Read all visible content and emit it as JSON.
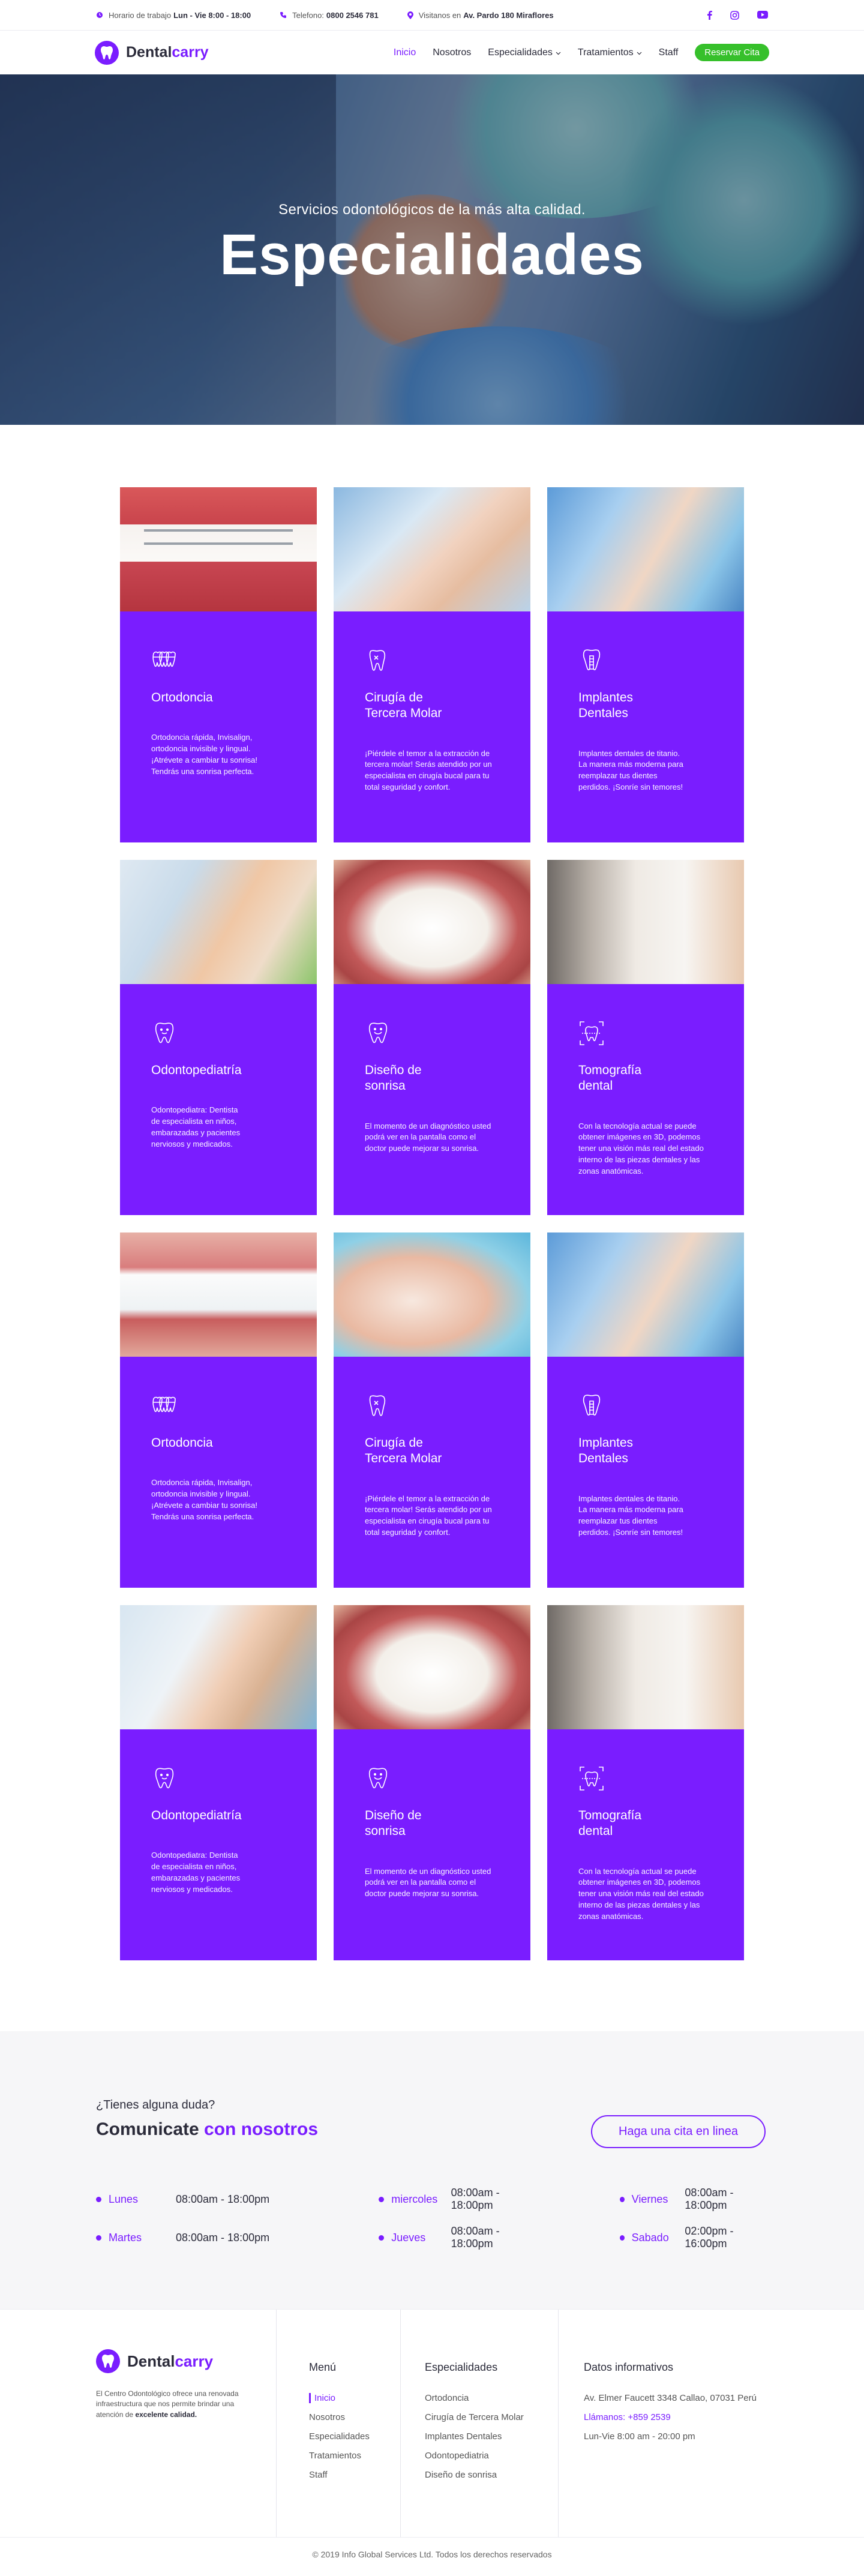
{
  "topbar": {
    "hours_label": "Horario de trabajo",
    "hours_value": "Lun - Vie 8:00 - 18:00",
    "phone_label": "Telefono:",
    "phone_value": "0800 2546 781",
    "visit_label": "Visitanos en",
    "visit_value": "Av. Pardo 180 Miraflores",
    "social": [
      "facebook-icon",
      "instagram-icon",
      "youtube-icon"
    ]
  },
  "nav": {
    "logo_dental": "Dental",
    "logo_carry": "carry",
    "items": [
      "Inicio",
      "Nosotros",
      "Especialidades",
      "Tratamientos",
      "Staff"
    ],
    "cta": "Reservar Cita"
  },
  "hero": {
    "subtitle": "Servicios odontológicos de la más alta calidad.",
    "title": "Especialidades"
  },
  "cards": [
    {
      "title": "Ortodoncia",
      "text": "Ortodoncia rápida, Invisalign,\nortodoncia invisible y lingual.\n¡Atrévete a cambiar tu sonrisa!\nTendrás una sonrisa perfecta.",
      "image": "teeth",
      "icon": "braces-tooth-icon"
    },
    {
      "title": "Cirugía de\nTercera Molar",
      "text": "¡Piérdele el temor a la extracción de\ntercera molar! Serás atendido por un\nespecialista en cirugía bucal para tu\ntotal seguridad y confort.",
      "image": "clinic",
      "icon": "molar-icon"
    },
    {
      "title": "Implantes\nDentales",
      "text": "Implantes dentales de titanio.\nLa manera más moderna para\nreemplazar tus dientes\nperdidos. ¡Sonríe sin temores!",
      "image": "clinic2",
      "icon": "implant-icon"
    },
    {
      "title": "Odontopediatría",
      "text": "Odontopediatra: Dentista\nde especialista en niños,\nembarazadas y pacientes\nnerviosos y medicados.",
      "image": "kid",
      "icon": "kid-tooth-icon"
    },
    {
      "title": "Diseño de\nsonrisa",
      "text": "El momento de un diagnóstico usted\npodrá ver en la pantalla como el\ndoctor puede mejorar su sonrisa.",
      "image": "smile",
      "icon": "smile-tooth-icon"
    },
    {
      "title": "Tomografía\ndental",
      "text": "Con la tecnología actual se puede\nobtener imágenes en 3D, podemos\ntener una visión más real del estado\ninterno de las piezas dentales y las\nzonas  anatómicas.",
      "image": "lab",
      "icon": "scan-icon"
    },
    {
      "title": "Ortodoncia",
      "text": "Ortodoncia rápida, Invisalign,\nortodoncia invisible y lingual.\n¡Atrévete a cambiar tu sonrisa!\nTendrás una sonrisa perfecta.",
      "image": "aligner",
      "icon": "braces-tooth-icon"
    },
    {
      "title": "Cirugía de\nTercera Molar",
      "text": "¡Piérdele el temor a la extracción de\ntercera molar! Serás atendido por un\nespecialista en cirugía bucal para tu\ntotal seguridad y confort.",
      "image": "mouth",
      "icon": "molar-icon"
    },
    {
      "title": "Implantes\nDentales",
      "text": "Implantes dentales de titanio.\nLa manera más moderna para\nreemplazar tus dientes\nperdidos. ¡Sonríe sin temores!",
      "image": "clinic2",
      "icon": "implant-icon"
    },
    {
      "title": "Odontopediatría",
      "text": "Odontopediatra: Dentista\nde especialista en niños,\nembarazadas y pacientes\nnerviosos y medicados.",
      "image": "portrait",
      "icon": "kid-tooth-icon"
    },
    {
      "title": "Diseño de\nsonrisa",
      "text": "El momento de un diagnóstico usted\npodrá ver en la pantalla como el\ndoctor puede mejorar su sonrisa.",
      "image": "smile",
      "icon": "smile-tooth-icon"
    },
    {
      "title": "Tomografía\ndental",
      "text": "Con la tecnología actual se puede\nobtener imágenes en 3D, podemos\ntener una visión más real del estado\ninterno de las piezas dentales y las\nzonas  anatómicas.",
      "image": "lab",
      "icon": "scan-icon"
    }
  ],
  "contact": {
    "question": "¿Tienes alguna duda?",
    "heading_main": "Comunicate ",
    "heading_accent": "con nosotros",
    "button": "Haga una cita en linea",
    "hours": [
      {
        "day": "Lunes",
        "time": "08:00am - 18:00pm"
      },
      {
        "day": "miercoles",
        "time": "08:00am - 18:00pm"
      },
      {
        "day": "Viernes",
        "time": "08:00am - 18:00pm"
      },
      {
        "day": "Martes",
        "time": "08:00am - 18:00pm"
      },
      {
        "day": "Jueves",
        "time": "08:00am - 18:00pm"
      },
      {
        "day": "Sabado",
        "time": "02:00pm - 16:00pm"
      }
    ]
  },
  "footer": {
    "about_text": "El Centro Odontológico ofrece una renovada infraestructura que nos permite brindar una atención de ",
    "about_bold": "excelente calidad.",
    "menu_title": "Menú",
    "menu_items": [
      "Inicio",
      "Nosotros",
      "Especialidades",
      "Tratamientos",
      "Staff"
    ],
    "spec_title": "Especialidades",
    "spec_items": [
      "Ortodoncia",
      "Cirugía de Tercera Molar",
      "Implantes Dentales",
      "Odontopediatria",
      "Diseño de sonrisa"
    ],
    "info_title": "Datos informativos",
    "address": "Av. Elmer Faucett 3348 Callao, 07031 Perú",
    "phone": "Llámanos: +859 2539",
    "schedule": "Lun-Vie 8:00 am - 20:00 pm",
    "copyright": "© 2019 Info Global Services Ltd. Todos los derechos reservados"
  },
  "colors": {
    "accent": "#7a1dff",
    "cta_green": "#36c02b",
    "contact_bg": "#f6f6f8"
  }
}
